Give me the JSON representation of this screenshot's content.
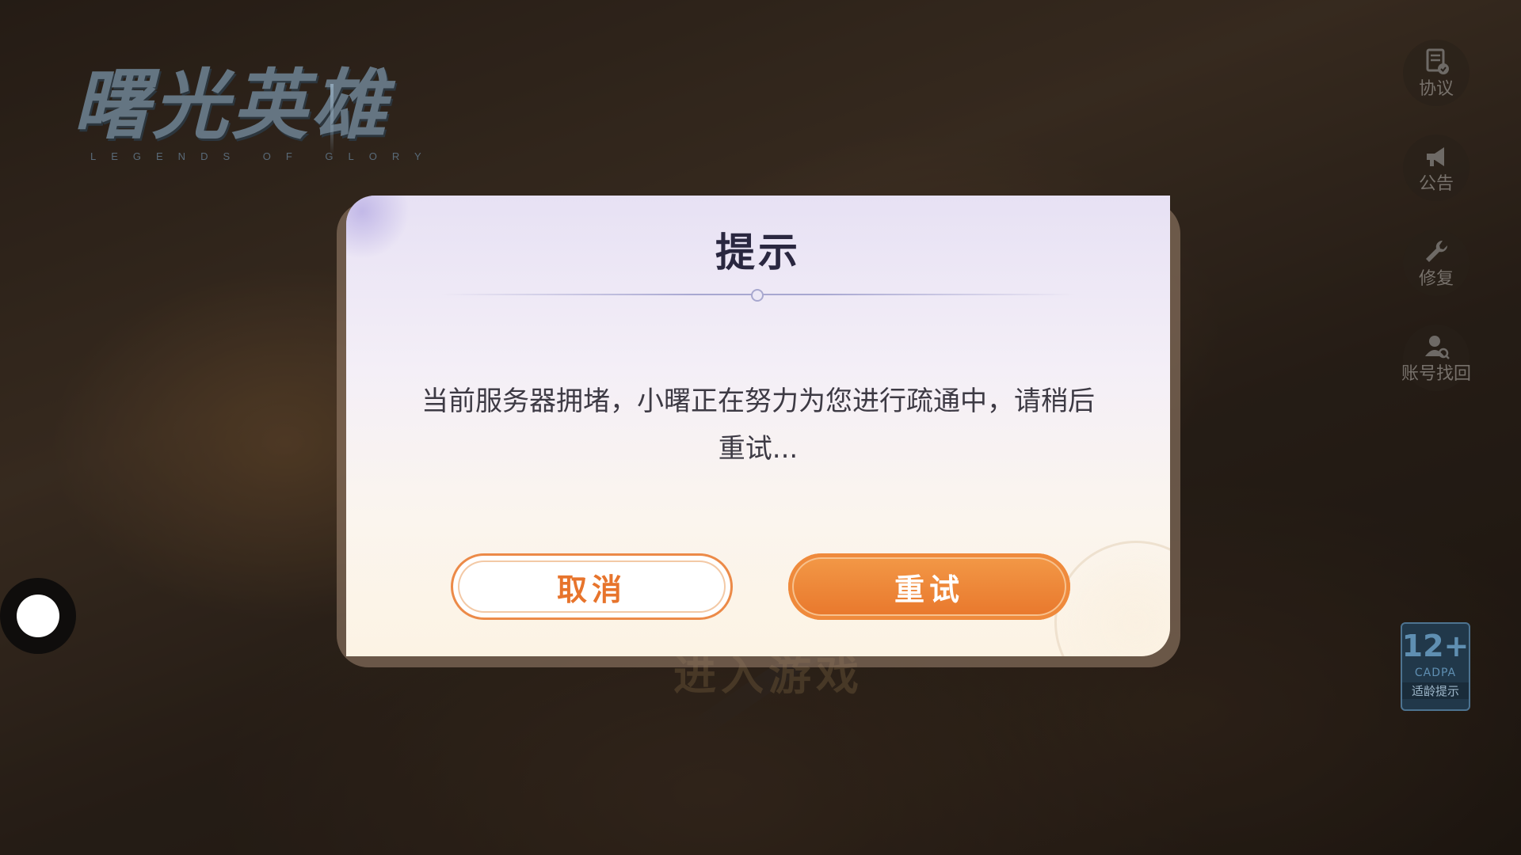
{
  "logo": {
    "title": "曙光英雄",
    "subtitle": "LEGENDS OF GLORY"
  },
  "side_menu": [
    {
      "label": "协议",
      "icon": "agreement-icon"
    },
    {
      "label": "公告",
      "icon": "megaphone-icon"
    },
    {
      "label": "修复",
      "icon": "wrench-icon"
    },
    {
      "label": "账号找回",
      "icon": "account-recovery-icon"
    }
  ],
  "age_rating": {
    "value": "12+",
    "org": "CADPA",
    "tip": "适龄提示"
  },
  "background": {
    "enter_game": "进入游戏"
  },
  "dialog": {
    "title": "提示",
    "message": "当前服务器拥堵，小曙正在努力为您进行疏通中，请稍后重试...",
    "cancel_label": "取消",
    "retry_label": "重试"
  },
  "colors": {
    "accent": "#e8762b",
    "title": "#2a2740",
    "age_badge": "#21384a"
  }
}
